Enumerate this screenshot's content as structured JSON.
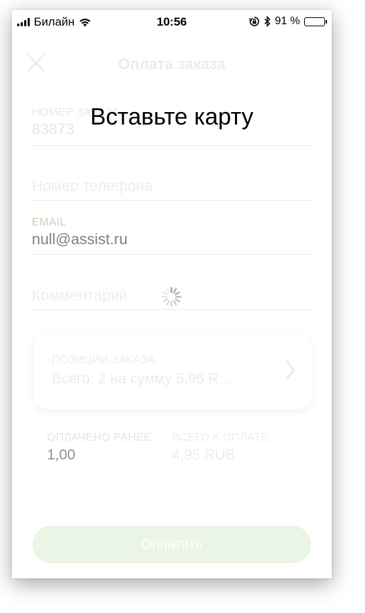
{
  "status_bar": {
    "carrier": "Билайн",
    "time": "10:56",
    "battery": "91 %"
  },
  "header": {
    "title": "Оплата заказа",
    "close_icon": "close-icon"
  },
  "form": {
    "order_number": {
      "label": "НОМЕР ЗАКАЗА",
      "value": "83873"
    },
    "phone": {
      "placeholder": "Номер телефона"
    },
    "email": {
      "label": "EMAIL",
      "value": "null@assist.ru"
    },
    "comment": {
      "placeholder": "Комментарий"
    }
  },
  "positions": {
    "label": "ПОЗИЦИИ ЗАКАЗА",
    "value": "Всего: 2 на сумму 5,95 R..."
  },
  "summary": {
    "paid": {
      "label": "ОПЛАЧЕНО РАНЕЕ",
      "value": "1,00"
    },
    "total": {
      "label": "ВСЕГО К ОПЛАТЕ",
      "value": "4,95 RUB"
    }
  },
  "pay_button": {
    "label": "Оплатить"
  },
  "overlay": {
    "message": "Вставьте карту"
  },
  "colors": {
    "accent_green": "#eaf5e6",
    "battery": "#f7c600"
  }
}
